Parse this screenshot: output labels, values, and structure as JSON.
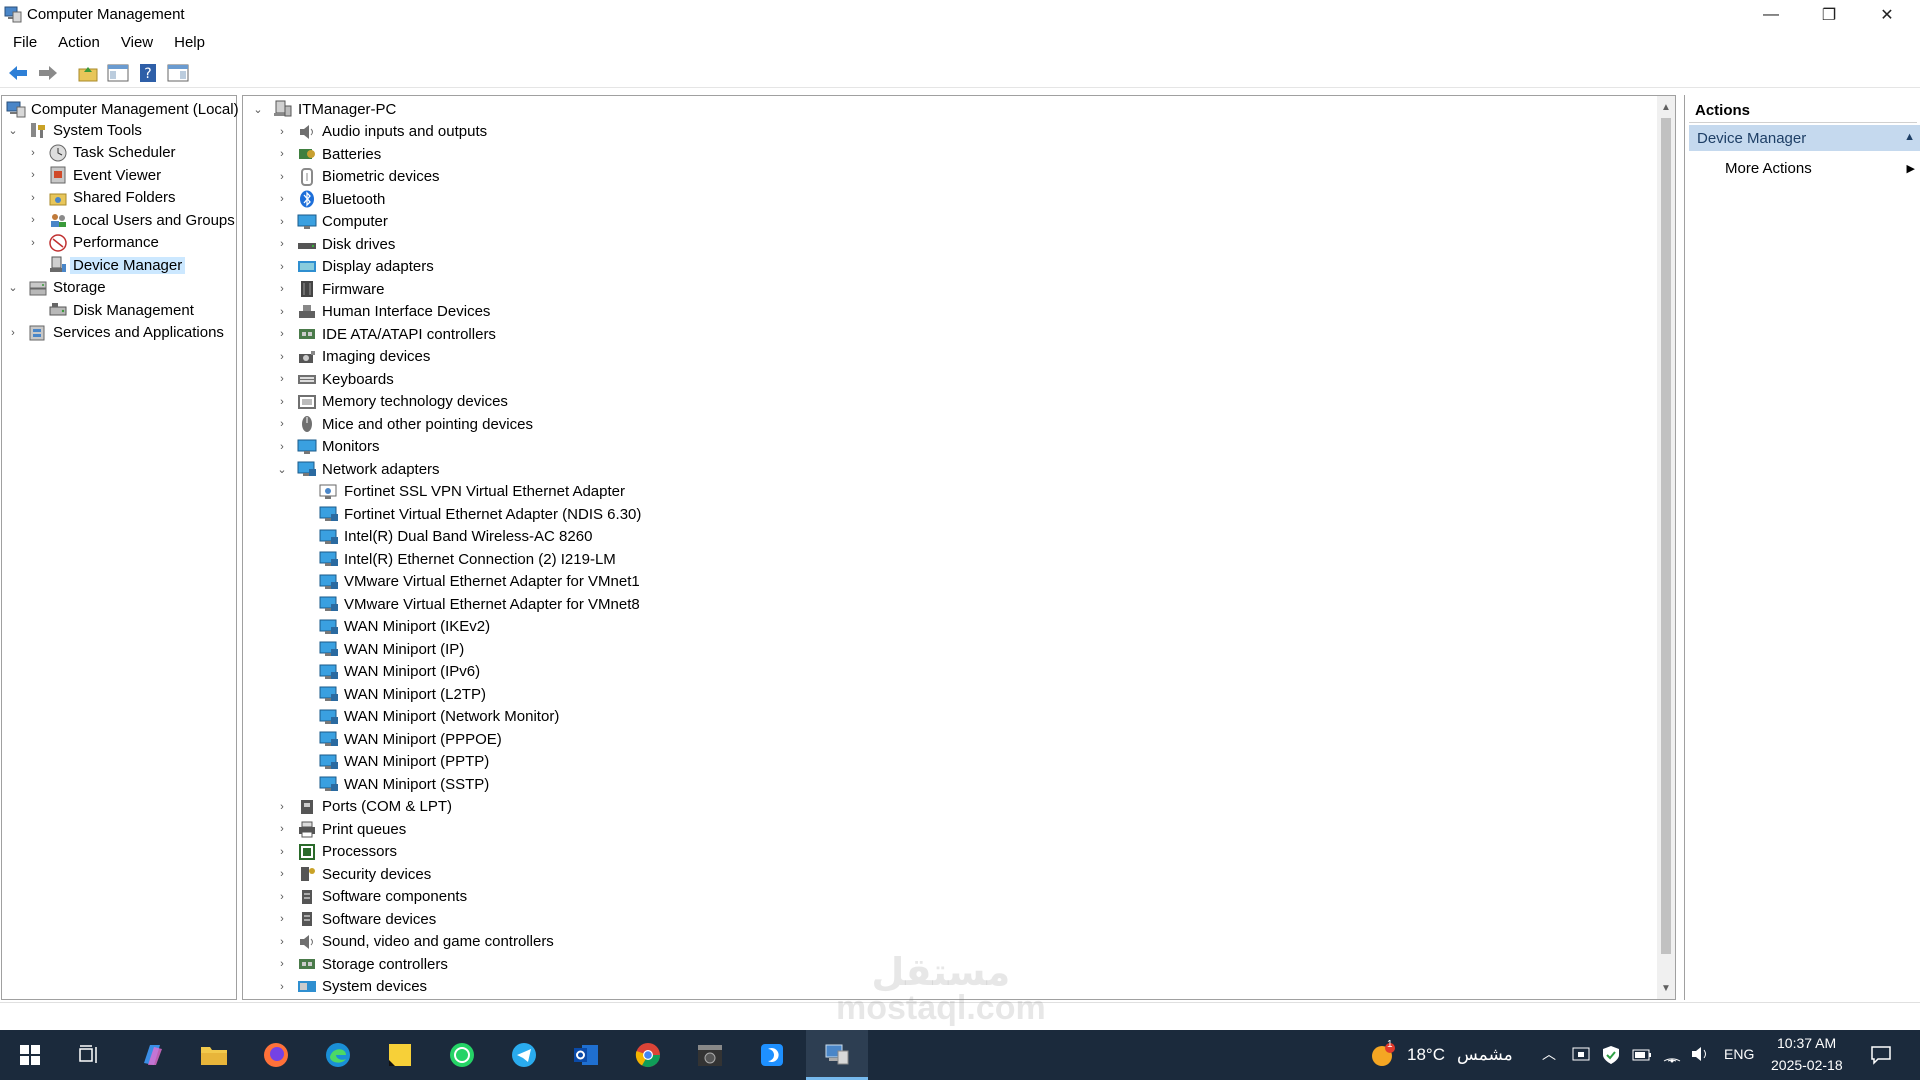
{
  "window": {
    "title": "Computer Management",
    "controls": [
      "—",
      "❐",
      "✕"
    ]
  },
  "menu": [
    "File",
    "Action",
    "View",
    "Help"
  ],
  "left_tree": {
    "root": "Computer Management (Local)",
    "items": [
      {
        "label": "System Tools",
        "level": 1,
        "expander": "expanded",
        "icon": "tools-icon"
      },
      {
        "label": "Task Scheduler",
        "level": 2,
        "expander": "collapsed",
        "icon": "clock-icon"
      },
      {
        "label": "Event Viewer",
        "level": 2,
        "expander": "collapsed",
        "icon": "event-viewer-icon"
      },
      {
        "label": "Shared Folders",
        "level": 2,
        "expander": "collapsed",
        "icon": "shared-folder-icon"
      },
      {
        "label": "Local Users and Groups",
        "level": 2,
        "expander": "collapsed",
        "icon": "users-icon"
      },
      {
        "label": "Performance",
        "level": 2,
        "expander": "collapsed",
        "icon": "performance-icon"
      },
      {
        "label": "Device Manager",
        "level": 2,
        "expander": "none",
        "icon": "device-manager-icon",
        "selected": true
      },
      {
        "label": "Storage",
        "level": 1,
        "expander": "expanded",
        "icon": "storage-icon"
      },
      {
        "label": "Disk Management",
        "level": 2,
        "expander": "none",
        "icon": "disk-management-icon"
      },
      {
        "label": "Services and Applications",
        "level": 1,
        "expander": "collapsed",
        "icon": "services-icon"
      }
    ]
  },
  "device_tree": {
    "root": "ITManager-PC",
    "categories": [
      {
        "label": "Audio inputs and outputs",
        "icon": "speaker-icon",
        "color": "#6f6f6f"
      },
      {
        "label": "Batteries",
        "icon": "battery-icon",
        "color": "#3f7f3f"
      },
      {
        "label": "Biometric devices",
        "icon": "fingerprint-icon",
        "color": "#8a8a8a"
      },
      {
        "label": "Bluetooth",
        "icon": "bluetooth-icon",
        "color": "#1e6fd9"
      },
      {
        "label": "Computer",
        "icon": "computer-icon",
        "color": "#3aa0e0"
      },
      {
        "label": "Disk drives",
        "icon": "disk-drive-icon",
        "color": "#555555"
      },
      {
        "label": "Display adapters",
        "icon": "display-adapter-icon",
        "color": "#2f8fd0"
      },
      {
        "label": "Firmware",
        "icon": "firmware-icon",
        "color": "#444444"
      },
      {
        "label": "Human Interface Devices",
        "icon": "hid-icon",
        "color": "#606060"
      },
      {
        "label": "IDE ATA/ATAPI controllers",
        "icon": "ide-controller-icon",
        "color": "#4a7a4a"
      },
      {
        "label": "Imaging devices",
        "icon": "camera-icon",
        "color": "#555555"
      },
      {
        "label": "Keyboards",
        "icon": "keyboard-icon",
        "color": "#707070"
      },
      {
        "label": "Memory technology devices",
        "icon": "memory-icon",
        "color": "#707070"
      },
      {
        "label": "Mice and other pointing devices",
        "icon": "mouse-icon",
        "color": "#707070"
      },
      {
        "label": "Monitors",
        "icon": "monitor-icon",
        "color": "#3aa0e0"
      },
      {
        "label": "Network adapters",
        "icon": "network-adapter-icon",
        "color": "#3aa0e0",
        "expanded": true,
        "children": [
          "Fortinet SSL VPN Virtual Ethernet Adapter",
          "Fortinet Virtual Ethernet Adapter (NDIS 6.30)",
          "Intel(R) Dual Band Wireless-AC 8260",
          "Intel(R) Ethernet Connection (2) I219-LM",
          "VMware Virtual Ethernet Adapter for VMnet1",
          "VMware Virtual Ethernet Adapter for VMnet8",
          "WAN Miniport (IKEv2)",
          "WAN Miniport (IP)",
          "WAN Miniport (IPv6)",
          "WAN Miniport (L2TP)",
          "WAN Miniport (Network Monitor)",
          "WAN Miniport (PPPOE)",
          "WAN Miniport (PPTP)",
          "WAN Miniport (SSTP)"
        ]
      },
      {
        "label": "Ports (COM & LPT)",
        "icon": "port-icon",
        "color": "#555555"
      },
      {
        "label": "Print queues",
        "icon": "printer-icon",
        "color": "#555555"
      },
      {
        "label": "Processors",
        "icon": "processor-icon",
        "color": "#2a6a2a"
      },
      {
        "label": "Security devices",
        "icon": "security-device-icon",
        "color": "#555555"
      },
      {
        "label": "Software components",
        "icon": "software-component-icon",
        "color": "#555555"
      },
      {
        "label": "Software devices",
        "icon": "software-device-icon",
        "color": "#555555"
      },
      {
        "label": "Sound, video and game controllers",
        "icon": "sound-icon",
        "color": "#6f6f6f"
      },
      {
        "label": "Storage controllers",
        "icon": "storage-controller-icon",
        "color": "#4a7a4a"
      },
      {
        "label": "System devices",
        "icon": "system-devices-icon",
        "color": "#2f8fd0"
      }
    ]
  },
  "actions": {
    "header": "Actions",
    "section": "Device Manager",
    "items": [
      "More Actions"
    ]
  },
  "taskbar": {
    "weather_temp": "18°C",
    "weather_desc": "مشمس",
    "weather_badge": "1",
    "language": "ENG",
    "time": "10:37 AM",
    "date": "2025-02-18"
  },
  "watermark": {
    "arabic": "مستقل",
    "latin": "mostaql.com"
  },
  "colors": {
    "selection": "#cce8ff",
    "actions_section_bg": "#c5d9ee",
    "taskbar_bg": "#1b2a3c",
    "accent": "#76b9ed"
  }
}
